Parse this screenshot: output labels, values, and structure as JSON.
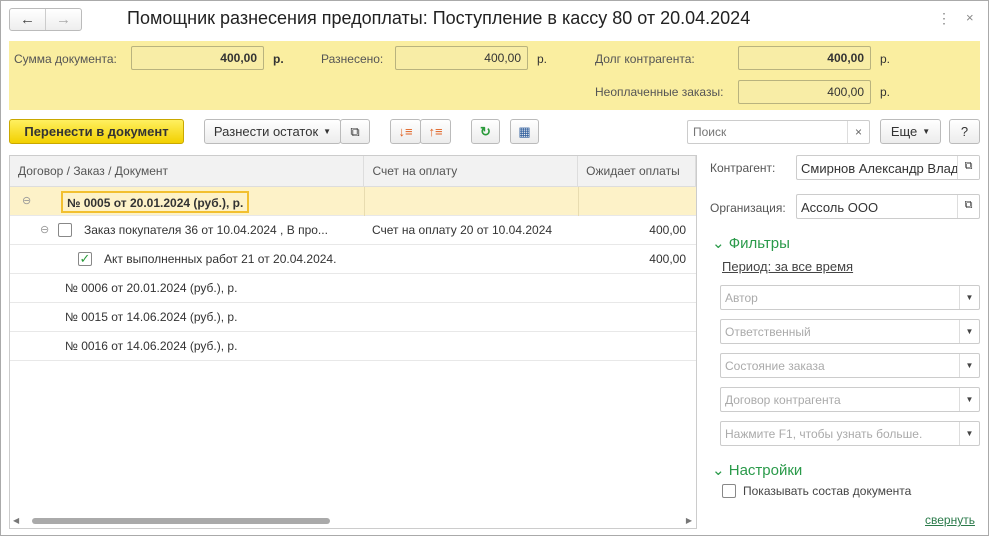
{
  "window": {
    "title": "Помощник разнесения предоплаты: Поступление в кассу 80 от 20.04.2024"
  },
  "header": {
    "doc_sum_label": "Сумма документа:",
    "doc_sum": "400,00",
    "currency": "р.",
    "allocated_label": "Разнесено:",
    "allocated": "400,00",
    "debt_label": "Долг контрагента:",
    "debt": "400,00",
    "unpaid_label": "Неоплаченные заказы:",
    "unpaid": "400,00"
  },
  "toolbar": {
    "transfer": "Перенести в документ",
    "distribute": "Разнести остаток",
    "search_placeholder": "Поиск",
    "more": "Еще",
    "help": "?"
  },
  "grid": {
    "columns": [
      "Договор / Заказ / Документ",
      "Счет на оплату",
      "Ожидает оплаты"
    ],
    "rows": [
      {
        "level": 0,
        "text": "№ 0005 от 20.01.2024 (руб.), р.",
        "invoice": "",
        "amount": "",
        "bold": true,
        "selected": true,
        "expander": true
      },
      {
        "level": 1,
        "text": "Заказ покупателя 36 от 10.04.2024 , В про...",
        "invoice": "Счет на оплату 20 от 10.04.2024",
        "amount": "400,00",
        "checkbox": "unchecked",
        "expander": true
      },
      {
        "level": 2,
        "text": "Акт выполненных работ 21 от 20.04.2024.",
        "invoice": "",
        "amount": "400,00",
        "checkbox": "checked"
      },
      {
        "level": 0,
        "text": "№ 0006 от 20.01.2024 (руб.), р.",
        "invoice": "",
        "amount": ""
      },
      {
        "level": 0,
        "text": "№ 0015 от 14.06.2024 (руб.), р.",
        "invoice": "",
        "amount": ""
      },
      {
        "level": 0,
        "text": "№ 0016 от 14.06.2024 (руб.), р.",
        "invoice": "",
        "amount": ""
      }
    ]
  },
  "panel": {
    "counterparty_label": "Контрагент:",
    "counterparty": "Смирнов Александр Влад",
    "org_label": "Организация:",
    "org": "Ассоль ООО",
    "filters_title": "Фильтры",
    "period": "Период: за все время",
    "filters": [
      "Автор",
      "Ответственный",
      "Состояние заказа",
      "Договор контрагента",
      "Нажмите F1, чтобы узнать больше."
    ],
    "settings_title": "Настройки",
    "show_composition": "Показывать состав документа",
    "collapse": "свернуть"
  }
}
